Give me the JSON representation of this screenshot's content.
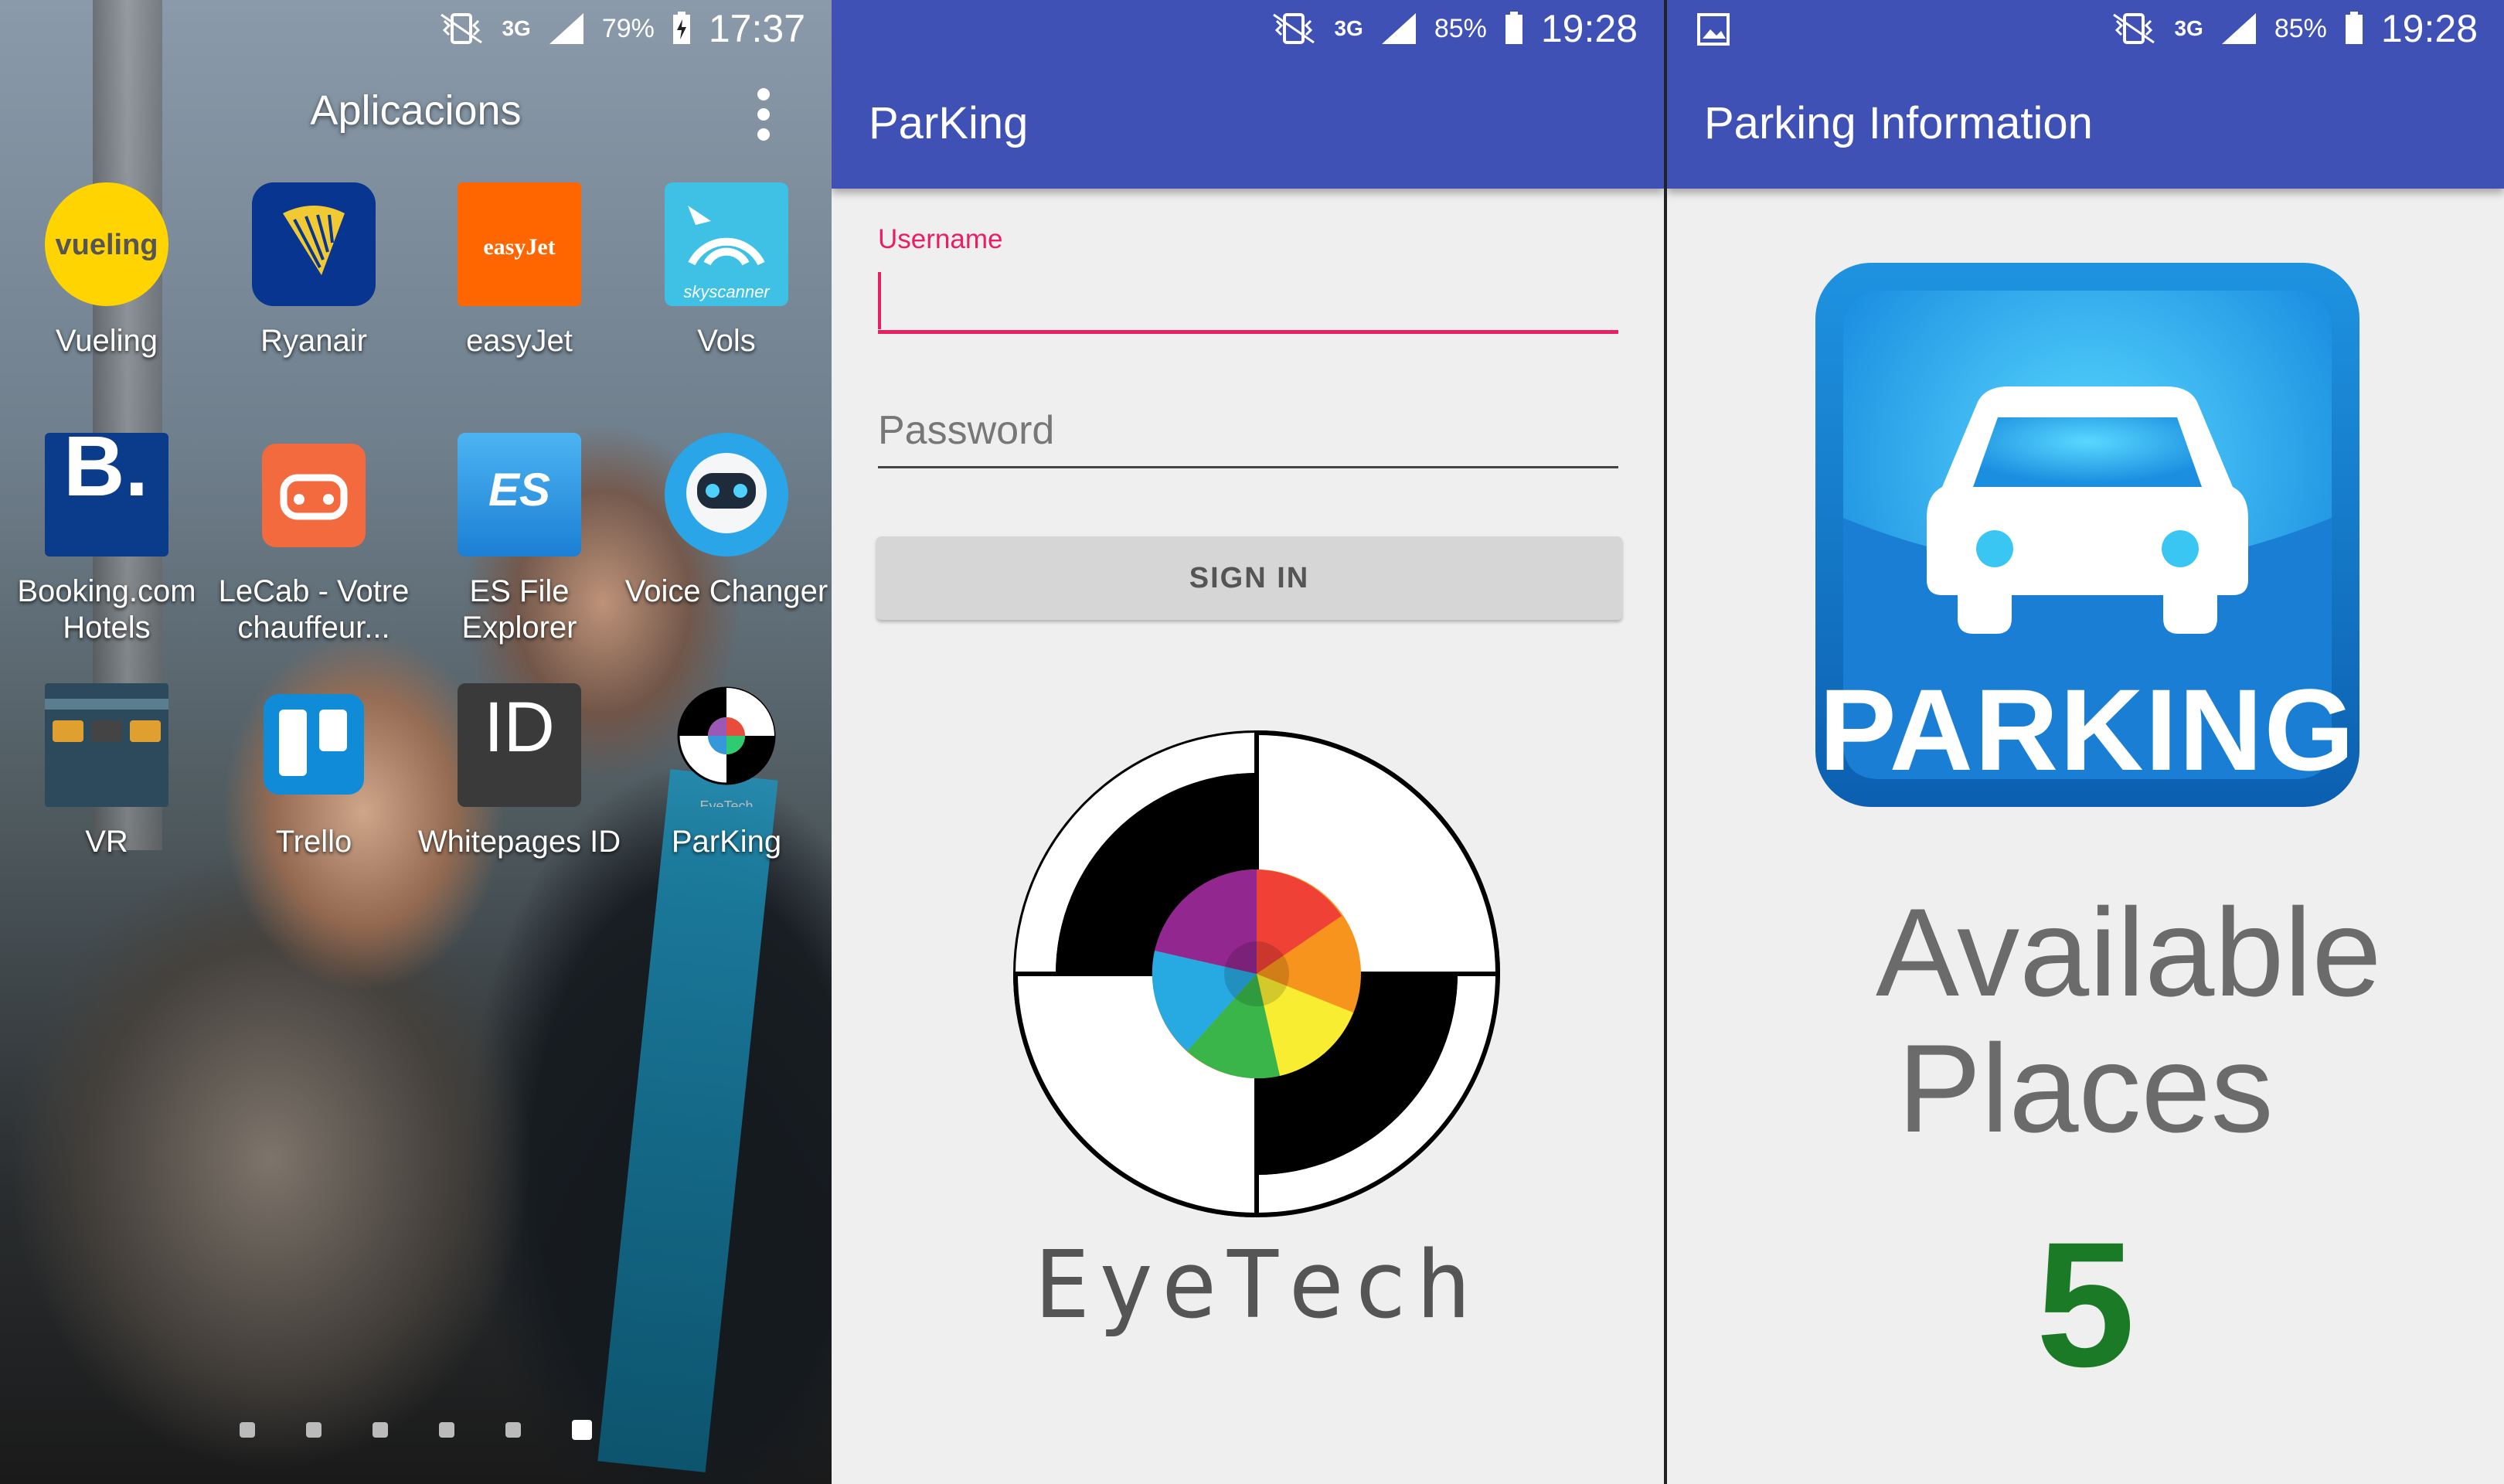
{
  "panels": {
    "launcher": {
      "status": {
        "time": "17:37",
        "battery": "79%",
        "network": "3G"
      },
      "folder_title": "Aplicacions",
      "apps": [
        {
          "label": "Vueling",
          "icon_text": "vueling"
        },
        {
          "label": "Ryanair"
        },
        {
          "label": "easyJet",
          "icon_text": "easyJet"
        },
        {
          "label": "Vols",
          "icon_text": "skyscanner"
        },
        {
          "label": "Booking.com Hotels",
          "icon_text": "B."
        },
        {
          "label": "LeCab - Votre chauffeur..."
        },
        {
          "label": "ES File Explorer",
          "icon_text": "ES"
        },
        {
          "label": "Voice Changer"
        },
        {
          "label": "VR"
        },
        {
          "label": "Trello"
        },
        {
          "label": "Whitepages ID",
          "icon_text": "ID"
        },
        {
          "label": "ParKing",
          "icon_text": "EyeTech"
        }
      ],
      "pages": 6,
      "current_page": 6
    },
    "login": {
      "status": {
        "time": "19:28",
        "battery": "85%",
        "network": "3G"
      },
      "app_title": "ParKing",
      "username_label": "Username",
      "username_value": "",
      "password_placeholder": "Password",
      "signin_label": "SIGN IN",
      "logo_text": "EyeTech"
    },
    "info": {
      "status": {
        "time": "19:28",
        "battery": "85%",
        "network": "3G"
      },
      "app_title": "Parking Information",
      "sign_text": "PARKING",
      "available_label": "Available Places",
      "available_count": "5"
    }
  },
  "colors": {
    "primary": "#3f51b5",
    "accent": "#e91e63",
    "count_green": "#1b7a26",
    "parking_blue": "#1c86d6"
  }
}
